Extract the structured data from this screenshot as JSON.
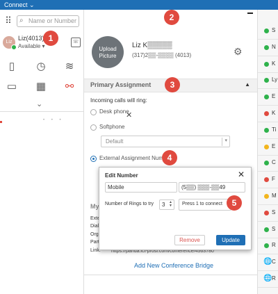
{
  "app": {
    "title": "Connect ⌄"
  },
  "left": {
    "search_placeholder": "Name or Number",
    "user": {
      "initials": "Liz",
      "name": "Liz(4013)",
      "status": "Available ▾"
    },
    "chevron": "⌄"
  },
  "callouts": [
    "1",
    "2",
    "3",
    "4",
    "5"
  ],
  "profile": {
    "upload_label": "Upload Picture",
    "name": "Liz K▒▒▒▒▒",
    "phone": "(317)2▒▒-▒▒▒▒ (4013)"
  },
  "primary_assignment": {
    "heading": "Primary Assignment",
    "caret": "▲",
    "incoming_label": "Incoming calls will ring:",
    "options": [
      "Desk phone",
      "Softphone",
      "External Assignment Number"
    ],
    "selected_option": "External Assignment Number",
    "softphone_select": "Default"
  },
  "edit_number": {
    "title": "Edit Number",
    "label_value": "Mobile",
    "number_value": "(5▒▒) ▒▒▒-▒▒49",
    "rings_label": "Number of Rings to try",
    "rings_value": "3",
    "press_value": "Press 1 to connect",
    "remove_label": "Remove",
    "update_label": "Update"
  },
  "conference": {
    "heading": "My",
    "lines": [
      "Exte",
      "Dial",
      "Org",
      "Part"
    ],
    "link_label": "Link:",
    "link_value": "https://panda.ict-prosi.com/conference/4563780",
    "add_label": "Add New Conference Bridge"
  },
  "contacts": [
    {
      "initial": "S",
      "status": "#2eb24b"
    },
    {
      "initial": "N",
      "status": "#2eb24b"
    },
    {
      "initial": "K",
      "status": "#2eb24b"
    },
    {
      "initial": "Ly",
      "status": "#2eb24b"
    },
    {
      "initial": "E",
      "status": "#2eb24b"
    },
    {
      "initial": "K",
      "status": "#e04a3f"
    },
    {
      "initial": "Ti",
      "status": "#2eb24b"
    },
    {
      "initial": "E",
      "status": "#f2b51d"
    },
    {
      "initial": "C",
      "status": "#2eb24b"
    },
    {
      "initial": "F",
      "status": "#e04a3f"
    },
    {
      "initial": "M",
      "status": "#f2b51d"
    },
    {
      "initial": "S",
      "status": "#e04a3f"
    },
    {
      "initial": "S",
      "status": "#2eb24b"
    },
    {
      "initial": "R",
      "status": "#2eb24b"
    },
    {
      "initial": "C",
      "status": "globe"
    },
    {
      "initial": "R",
      "status": "globe"
    }
  ]
}
